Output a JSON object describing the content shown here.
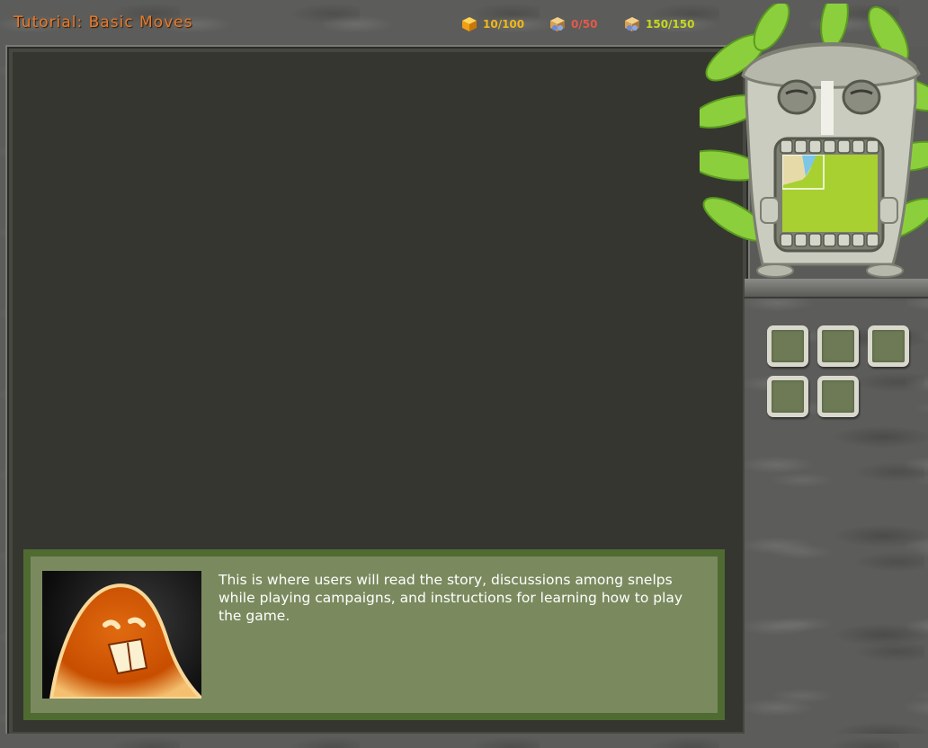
{
  "header": {
    "title": "Tutorial: Basic Moves",
    "resources": [
      {
        "icon": "cube-icon",
        "label": "10/100",
        "color": "#f0b81a"
      },
      {
        "icon": "crate-icon",
        "label": "0/50",
        "color": "#e35a4a"
      },
      {
        "icon": "crate-icon",
        "label": "150/150",
        "color": "#c6d81e"
      }
    ]
  },
  "dialog": {
    "text": "This is where users will read the story, discussions among snelps while playing campaigns, and instructions for learning how to play the game.",
    "portrait": "snelp-portrait"
  },
  "sidebar": {
    "slots": [
      "command-slot",
      "command-slot",
      "command-slot",
      "command-slot",
      "command-slot"
    ]
  },
  "colors": {
    "title": "#e87a2a",
    "board": "#363630",
    "dialog_border": "#4f6b31",
    "dialog_fill": "#7a8a5e",
    "minimap": "#a8d030"
  }
}
